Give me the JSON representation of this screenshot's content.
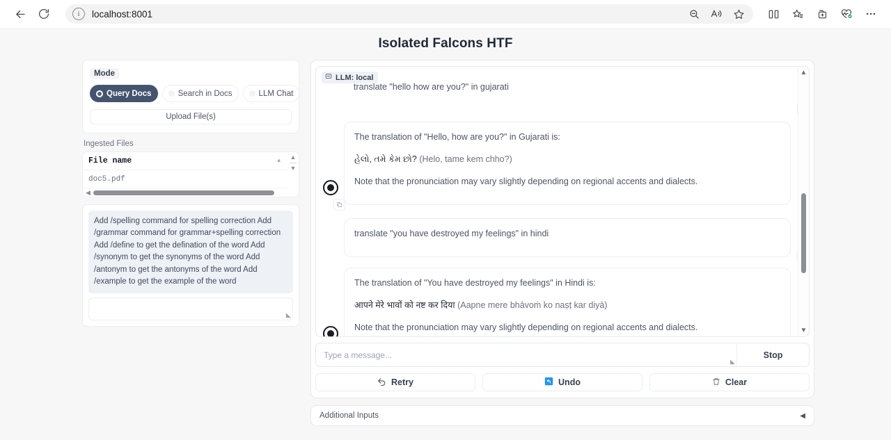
{
  "browser": {
    "url": "localhost:8001",
    "icons": {
      "back": "back-arrow-icon",
      "reload": "reload-icon",
      "info": "info-icon",
      "zoom_out": "zoom-out-icon",
      "read_aloud": "read-aloud-icon",
      "favorite": "favorite-star-icon",
      "split_screen": "split-screen-icon",
      "collections": "collections-icon",
      "add_tab_group": "add-tab-group-icon",
      "browser_essentials": "browser-essentials-icon",
      "settings_more": "more-options-icon"
    }
  },
  "page": {
    "title": "Isolated Falcons HTF"
  },
  "sidebar": {
    "mode_label": "Mode",
    "modes": [
      {
        "label": "Query Docs",
        "selected": true
      },
      {
        "label": "Search in Docs",
        "selected": false
      },
      {
        "label": "LLM Chat",
        "selected": false
      }
    ],
    "upload_label": "Upload File(s)",
    "ingested_label": "Ingested Files",
    "file_table": {
      "column": "File name",
      "rows": [
        "doc5.pdf"
      ]
    },
    "hint_text": "Add /spelling command for spelling correction Add /grammar command for grammar+spelling correction Add /define to get the defination of the word Add /synonym to get the synonyms of the word Add /antonym to get the antonyms of the word Add /example to get the example of the word",
    "extra_input_value": ""
  },
  "chat": {
    "header_chip": "LLM: local",
    "messages": [
      {
        "role": "user",
        "text": "translate \"hello how are you?\" in gujarati"
      },
      {
        "role": "bot",
        "intro": "The translation of \"Hello, how are you?\" in Gujarati is:",
        "native": "હેલો, તમે કેમ છો?",
        "translit": "(Helo, tame kem chho?)",
        "note": "Note that the pronunciation may vary slightly depending on regional accents and dialects."
      },
      {
        "role": "user",
        "text": "translate \"you have destroyed my feelings\" in hindi"
      },
      {
        "role": "bot",
        "intro": "The translation of \"You have destroyed my feelings\" in Hindi is:",
        "native": "आपने मेरे भावों को नष्ट कर दिया",
        "translit": "(Aapne mere bhāvoṁ ko naṣṭ kar diyā)",
        "note": "Note that the pronunciation may vary slightly depending on regional accents and dialects."
      }
    ],
    "input_placeholder": "Type a message...",
    "input_value": "",
    "stop_label": "Stop",
    "actions": [
      {
        "label": "Retry",
        "icon": "retry-icon"
      },
      {
        "label": "Undo",
        "icon": "undo-icon"
      },
      {
        "label": "Clear",
        "icon": "trash-icon"
      }
    ],
    "additional_inputs_label": "Additional Inputs"
  },
  "colors": {
    "accent_dark": "#44546e",
    "undo_blue": "#2196f3",
    "page_bg": "#f7f7f8",
    "hint_bg": "#eef1f6"
  }
}
